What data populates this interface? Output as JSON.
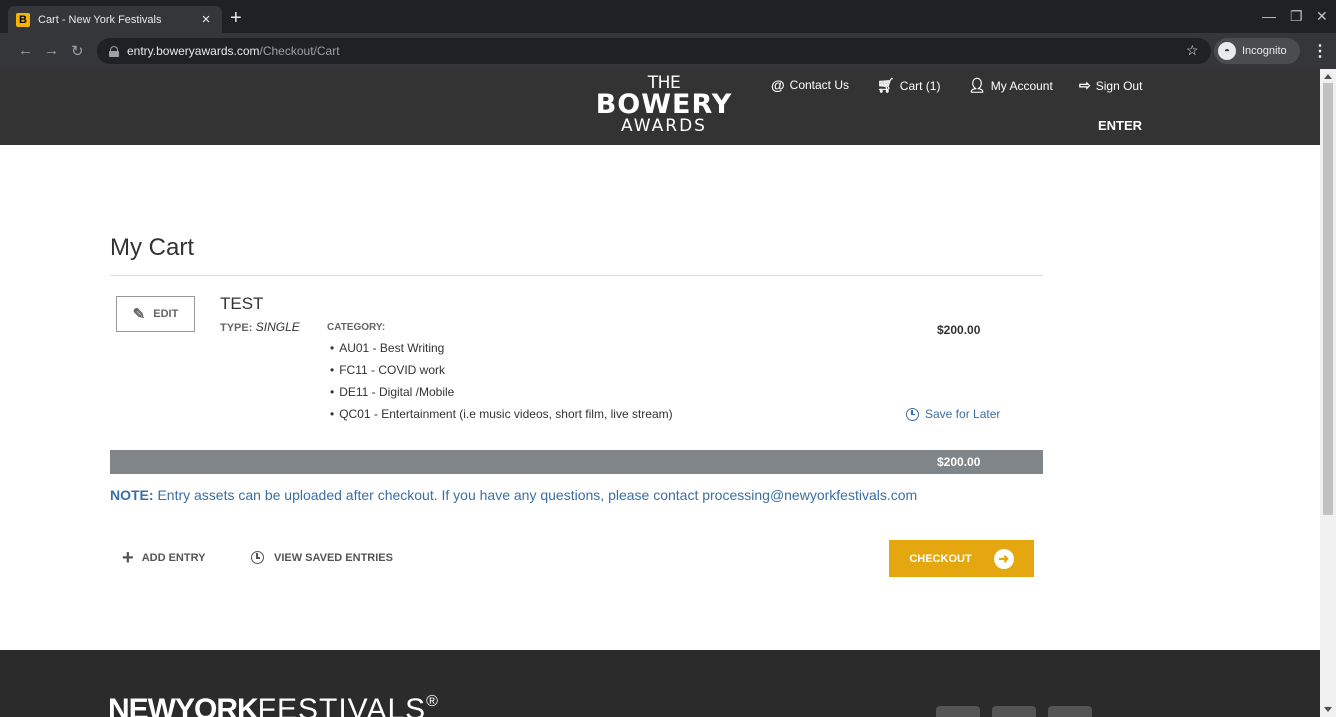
{
  "browser": {
    "tab_title": "Cart - New York Festivals",
    "tab_favicon": "B",
    "url_host": "entry.boweryawards.com",
    "url_path": "/Checkout/Cart",
    "incognito_label": "Incognito"
  },
  "header": {
    "logo_the": "THE",
    "logo_bowery": "BOWERY",
    "logo_awards": "AWARDS",
    "contact": "Contact Us",
    "cart": "Cart (1)",
    "account": "My Account",
    "signout": "Sign Out",
    "enter": "ENTER"
  },
  "cart": {
    "title": "My Cart",
    "edit_label": "EDIT",
    "entry": {
      "name": "TEST",
      "type_label": "TYPE:",
      "type_value": "SINGLE",
      "category_label": "CATEGORY:",
      "categories": [
        "AU01 - Best Writing",
        "FC11 - COVID work",
        "DE11 - Digital /Mobile",
        "QC01 - Entertainment (i.e music videos, short film, live stream)"
      ],
      "price": "$200.00",
      "save_later": "Save for Later"
    },
    "total": "$200.00",
    "note_label": "NOTE:",
    "note_text": " Entry assets can be uploaded after checkout. If you have any questions, please contact processing@newyorkfestivals.com",
    "add_entry": "ADD ENTRY",
    "view_saved": "VIEW SAVED ENTRIES",
    "checkout": "CHECKOUT"
  },
  "footer": {
    "logo_bold": "NEWYORK",
    "logo_light": "FESTIVALS",
    "logo_reg": "®"
  },
  "colors": {
    "header_bg": "#333333",
    "accent": "#e4a70f",
    "link": "#3a6fa6",
    "total_bar": "#808589"
  }
}
